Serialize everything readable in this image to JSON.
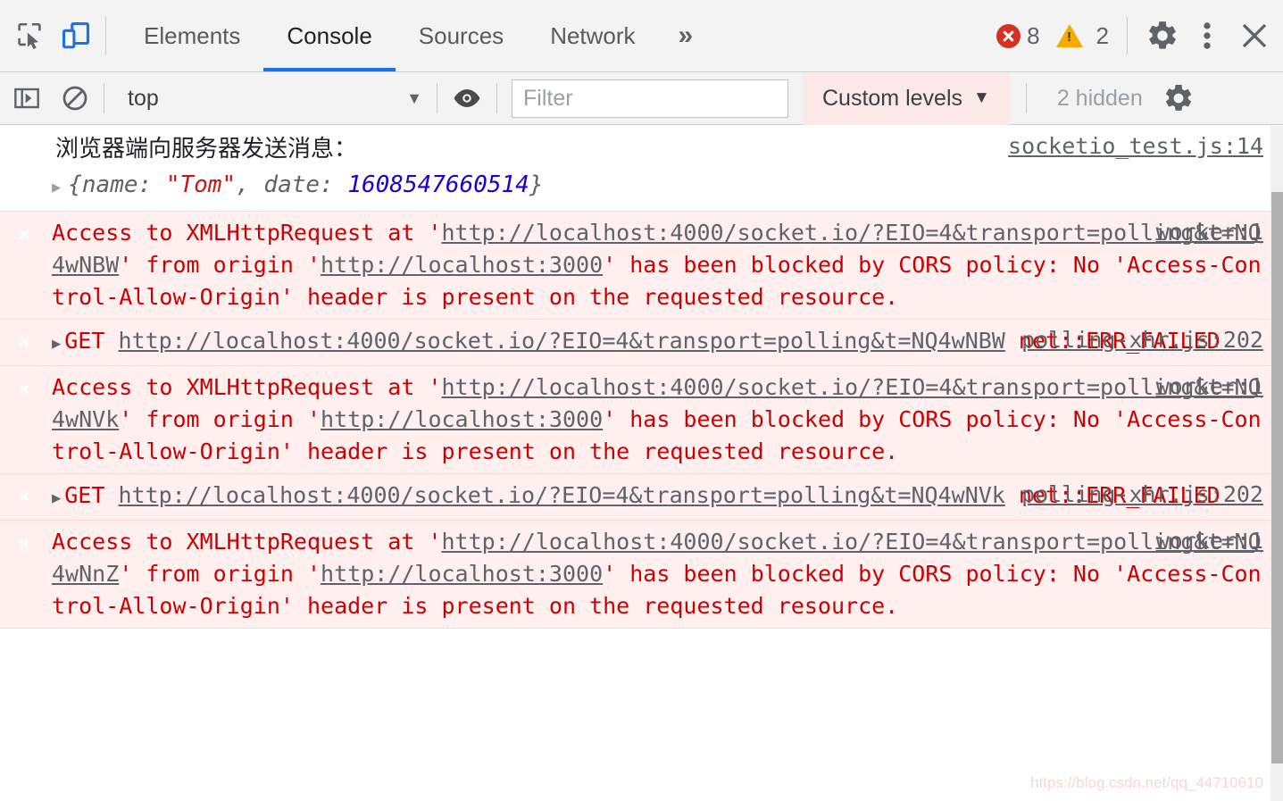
{
  "devtools": {
    "tabs": [
      {
        "label": "Elements",
        "active": false
      },
      {
        "label": "Console",
        "active": true
      },
      {
        "label": "Sources",
        "active": false
      },
      {
        "label": "Network",
        "active": false
      }
    ],
    "more_tabs_glyph": "»",
    "inspect_icon": "inspect-element-icon",
    "device_icon": "device-toolbar-icon",
    "error_count": "8",
    "warning_count": "2",
    "settings_icon": "gear-icon",
    "more_icon": "kebab-menu-icon",
    "close_icon": "close-icon"
  },
  "filterbar": {
    "sidebar_toggle_icon": "console-sidebar-icon",
    "clear_icon": "clear-console-icon",
    "context": "top",
    "context_caret": "▼",
    "eye_icon": "live-expression-icon",
    "filter_placeholder": "Filter",
    "filter_value": "",
    "levels_label": "Custom levels",
    "levels_caret": "▼",
    "hidden_label": "2 hidden",
    "settings_icon": "console-settings-gear-icon"
  },
  "console": {
    "messages": [
      {
        "type": "log",
        "line1": "浏览器端向服务器发送消息：",
        "object_prefix": "{name: ",
        "object_string": "\"Tom\"",
        "object_mid": ", date: ",
        "object_number": "1608547660514",
        "object_suffix": "}",
        "source": "socketio_test.js:14"
      },
      {
        "type": "error",
        "kind": "cors",
        "pre": "Access to XMLHttpRequest at '",
        "url": "http://localhost:4000/socket.io/?EIO=4&transport=polling&t=NQ4wNBW",
        "mid": "' from origin '",
        "origin": "http://localhost:3000",
        "post": "' has been blocked by CORS policy: No 'Access-Control-Allow-Origin' header is present on the requested resource.",
        "source": "worker:1"
      },
      {
        "type": "error",
        "kind": "get",
        "method": "GET",
        "url": "http://localhost:4000/socket.io/?EIO=4&transport=polling&t=NQ4wNBW",
        "post": " net::ERR_FAILED",
        "source": "polling-xhr.js:202"
      },
      {
        "type": "error",
        "kind": "cors",
        "pre": "Access to XMLHttpRequest at '",
        "url": "http://localhost:4000/socket.io/?EIO=4&transport=polling&t=NQ4wNVk",
        "mid": "' from origin '",
        "origin": "http://localhost:3000",
        "post": "' has been blocked by CORS policy: No 'Access-Control-Allow-Origin' header is present on the requested resource.",
        "source": "worker:1"
      },
      {
        "type": "error",
        "kind": "get",
        "method": "GET",
        "url": "http://localhost:4000/socket.io/?EIO=4&transport=polling&t=NQ4wNVk",
        "post": " net::ERR_FAILED",
        "source": "polling-xhr.js:202"
      },
      {
        "type": "error",
        "kind": "cors",
        "pre": "Access to XMLHttpRequest at '",
        "url": "http://localhost:4000/socket.io/?EIO=4&transport=polling&t=NQ4wNnZ",
        "mid": "' from origin '",
        "origin": "http://localhost:3000",
        "post": "' has been blocked by CORS policy: No 'Access-Control-Allow-Origin' header is present on the requested resource.",
        "source": "worker:1"
      }
    ]
  },
  "watermark": "https://blog.csdn.net/qq_44710610",
  "colors": {
    "accent": "#1a73e8",
    "error_red": "#cc0000",
    "error_bg": "#fff0ef",
    "warn_yellow": "#f5ab00",
    "toolbar_bg": "#f3f3f3",
    "levels_bg": "#fce8e6"
  }
}
